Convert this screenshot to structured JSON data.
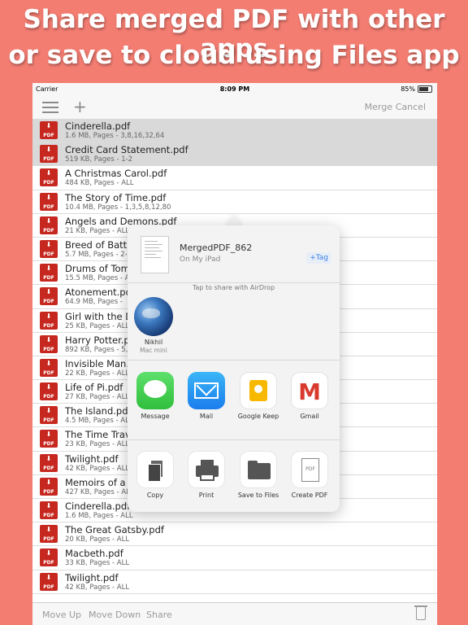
{
  "banner": {
    "line1": "Share merged PDF with other apps",
    "line2": "or save to cloud using Files app"
  },
  "status": {
    "carrier": "Carrier",
    "time": "8:09 PM",
    "battery": "85%"
  },
  "nav": {
    "merge": "Merge",
    "cancel": "Cancel"
  },
  "pdf_icon_label": "PDF",
  "files": [
    {
      "name": "Cinderella.pdf",
      "meta": "1.6 MB, Pages - 3,8,16,32,64"
    },
    {
      "name": "Credit Card Statement.pdf",
      "meta": "519 KB, Pages - 1-2"
    },
    {
      "name": "A Christmas Carol.pdf",
      "meta": "484 KB, Pages - ALL"
    },
    {
      "name": "The Story of Time.pdf",
      "meta": "10.4 MB, Pages - 1,3,5,8,12,80"
    },
    {
      "name": "Angels and Demons.pdf",
      "meta": "21 KB, Pages - ALL"
    },
    {
      "name": "Breed of Battle",
      "meta": "5.7 MB, Pages - 2-"
    },
    {
      "name": "Drums of Tomb",
      "meta": "15.5 MB, Pages - A"
    },
    {
      "name": "Atonement.pdf",
      "meta": "64.9 MB, Pages -"
    },
    {
      "name": "Girl with the Dr",
      "meta": "25 KB, Pages - ALL"
    },
    {
      "name": "Harry Potter.pd",
      "meta": "892 KB, Pages - 5,"
    },
    {
      "name": "Invisible Man.p",
      "meta": "22 KB, Pages - ALL"
    },
    {
      "name": "Life of Pi.pdf",
      "meta": "27 KB, Pages - ALL"
    },
    {
      "name": "The Island.pdf",
      "meta": "4.5 MB, Pages - AL"
    },
    {
      "name": "The Time Trave",
      "meta": "23 KB, Pages - ALL"
    },
    {
      "name": "Twilight.pdf",
      "meta": "42 KB, Pages - ALL"
    },
    {
      "name": "Memoirs of a G",
      "meta": "427 KB, Pages - AL"
    },
    {
      "name": "Cinderella.pdf",
      "meta": "1.6 MB, Pages - ALL"
    },
    {
      "name": "The Great Gatsby.pdf",
      "meta": "20 KB, Pages - ALL"
    },
    {
      "name": "Macbeth.pdf",
      "meta": "33 KB, Pages - ALL"
    },
    {
      "name": "Twilight.pdf",
      "meta": "42 KB, Pages - ALL"
    }
  ],
  "toolbar": {
    "move_up": "Move Up",
    "move_down": "Move Down",
    "share": "Share"
  },
  "share_sheet": {
    "file_name": "MergedPDF_862",
    "location": "On My iPad",
    "tag": "+Tag",
    "airdrop_hint": "Tap to share with AirDrop",
    "airdrop_person": {
      "name": "Nikhil",
      "device": "Mac mini"
    },
    "apps": [
      {
        "label": "Message",
        "icon": "message-icon"
      },
      {
        "label": "Mail",
        "icon": "mail-icon"
      },
      {
        "label": "Google Keep",
        "icon": "google-keep-icon"
      },
      {
        "label": "Gmail",
        "icon": "gmail-icon"
      }
    ],
    "actions": [
      {
        "label": "Copy",
        "icon": "copy-icon"
      },
      {
        "label": "Print",
        "icon": "print-icon"
      },
      {
        "label": "Save to Files",
        "icon": "folder-icon"
      },
      {
        "label": "Create PDF",
        "icon": "create-pdf-icon"
      }
    ],
    "gmail_letter": "M",
    "create_pdf_doc_text": "PDF"
  }
}
